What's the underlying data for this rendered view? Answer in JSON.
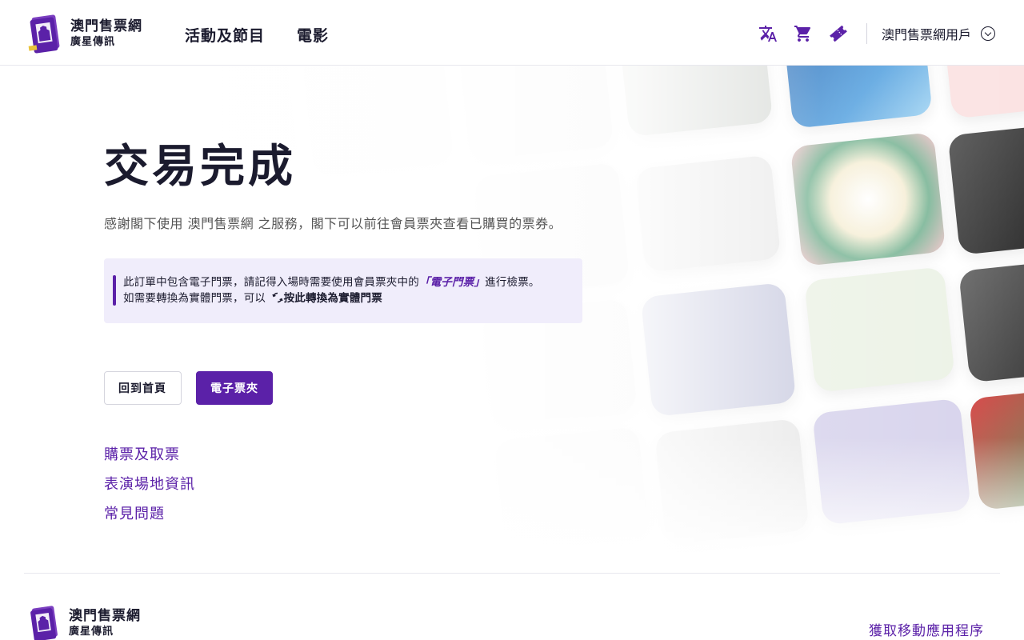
{
  "brand": {
    "name": "澳門售票網",
    "sub": "廣星傳訊"
  },
  "nav": {
    "items": [
      {
        "label": "活動及節目"
      },
      {
        "label": "電影"
      }
    ]
  },
  "header": {
    "icons": [
      "translate-icon",
      "cart-icon",
      "ticket-icon"
    ],
    "user_label": "澳門售票網用戶"
  },
  "main": {
    "title": "交易完成",
    "lead": "感謝閣下使用 澳門售票網 之服務，閣下可以前往會員票夾查看已購買的票券。",
    "notice": {
      "line1_pre": "此訂單中包含電子門票，請記得入場時需要使用會員票夾中的",
      "line1_hl": "「電子門票」",
      "line1_post": "進行檢票。",
      "line2_pre": "如需要轉換為實體門票，可以",
      "line2_bold": "按此轉換為實體門票"
    },
    "buttons": {
      "home": "回到首頁",
      "wallet": "電子票夾"
    },
    "links": [
      {
        "label": "購票及取票"
      },
      {
        "label": "表演場地資訊"
      },
      {
        "label": "常見問題"
      }
    ]
  },
  "footer": {
    "app_link": "獲取移動應用程序"
  },
  "colors": {
    "accent": "#5b21a8",
    "notice_bg": "#f0edfb",
    "text_dark": "#1b1b2e"
  }
}
